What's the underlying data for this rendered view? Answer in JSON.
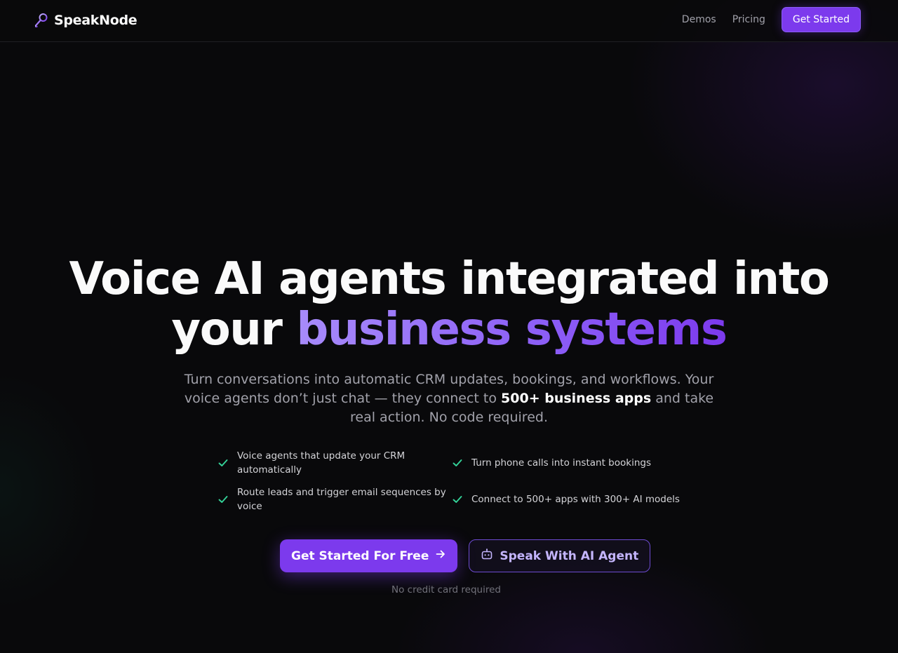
{
  "brand": {
    "name": "SpeakNode",
    "icon": "microphone-icon",
    "accent": "#7c3aed"
  },
  "nav": {
    "links": [
      "Demos",
      "Pricing"
    ],
    "cta_label": "Get Started"
  },
  "hero": {
    "title_line1": "Voice AI agents integrated into",
    "title_line2_plain": "your",
    "title_line2_accent": "business systems",
    "subtitle_before": "Turn conversations into automatic CRM updates, bookings, and workflows. Your voice agents don’t just chat — they connect to",
    "subtitle_highlight": "500+ business apps",
    "subtitle_after": "and take real action. No code required."
  },
  "features": [
    "Voice agents that update your CRM automatically",
    "Turn phone calls into instant bookings",
    "Route leads and trigger email sequences by voice",
    "Connect to 500+ apps with 300+ AI models"
  ],
  "cta": {
    "primary_label": "Get Started For Free",
    "primary_icon": "arrow-right-icon",
    "secondary_label": "Speak With AI Agent",
    "secondary_icon": "bot-icon",
    "note": "No credit card required"
  },
  "colors": {
    "background": "#09090b",
    "accent": "#7c3aed",
    "accent_light": "#a78bfa",
    "check": "#34d399"
  }
}
